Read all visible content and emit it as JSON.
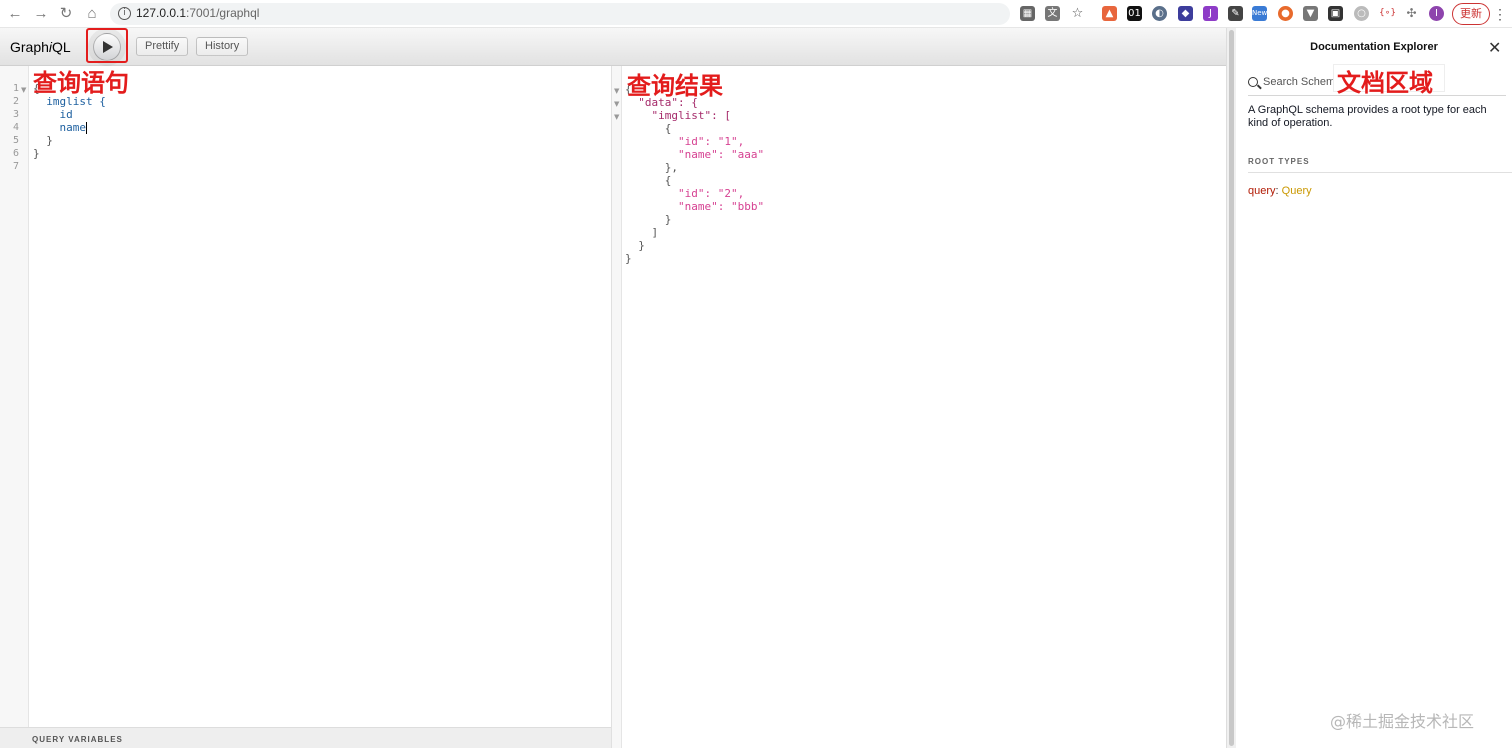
{
  "browser": {
    "url_host": "127.0.0.1",
    "url_rest": ":7001/graphql",
    "update_label": "更新",
    "profile_initial": "I"
  },
  "toolbar": {
    "logo_prefix": "Graph",
    "logo_i": "i",
    "logo_suffix": "QL",
    "prettify_label": "Prettify",
    "history_label": "History"
  },
  "annotations": {
    "query": "查询语句",
    "result": "查询结果",
    "docs": "文档区域"
  },
  "query_editor": {
    "line_numbers": [
      "1",
      "2",
      "3",
      "4",
      "5",
      "6",
      "7"
    ],
    "lines": [
      "{",
      "  imglist {",
      "    id",
      "    name",
      "  }",
      "}",
      ""
    ]
  },
  "query_variables_label": "QUERY VARIABLES",
  "result_lines": [
    "{",
    "  \"data\": {",
    "    \"imglist\": [",
    "      {",
    "        \"id\": \"1\",",
    "        \"name\": \"aaa\"",
    "      },",
    "      {",
    "        \"id\": \"2\",",
    "        \"name\": \"bbb\"",
    "      }",
    "    ]",
    "  }",
    "}"
  ],
  "docs": {
    "title": "Documentation Explorer",
    "search_placeholder": "Search Schema...",
    "description": "A GraphQL schema provides a root type for each kind of operation.",
    "root_types_label": "ROOT TYPES",
    "query_field": "query",
    "query_type": "Query"
  },
  "watermark": "@稀土掘金技术社区",
  "colors": {
    "annotation_red": "#e31c1c",
    "json_key": "#a52a6a",
    "json_string": "#d64292",
    "field": "#1f61a0",
    "type_name": "#ca9800"
  }
}
